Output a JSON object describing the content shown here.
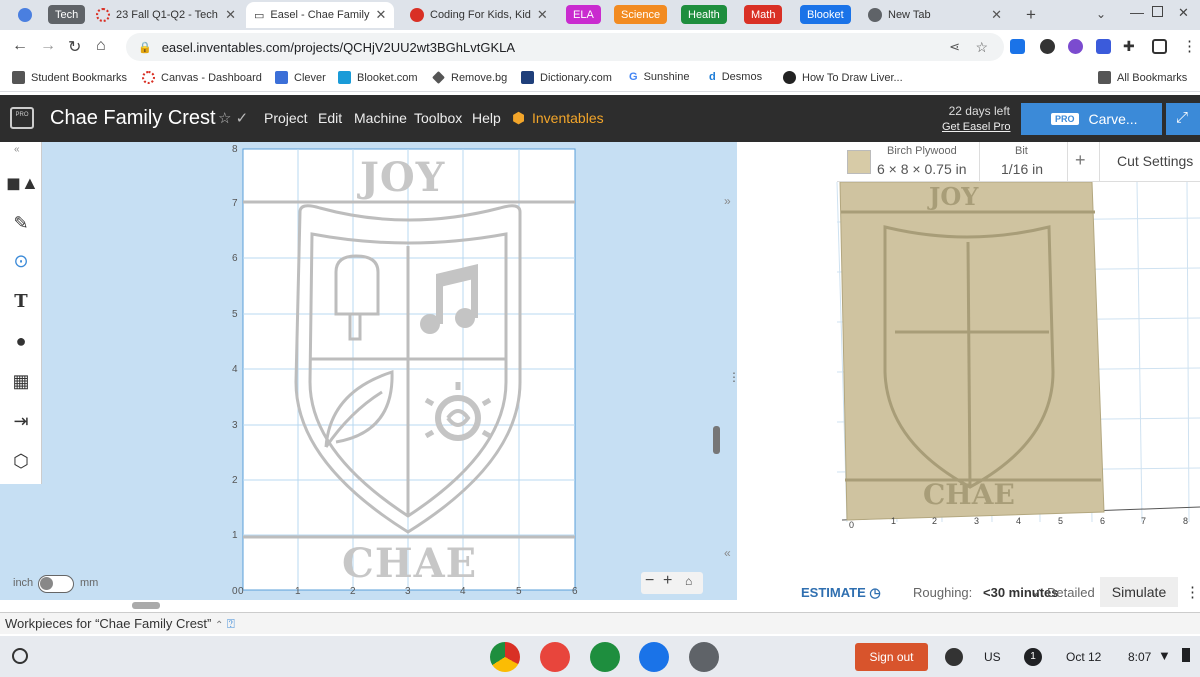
{
  "browser": {
    "tabs": [
      {
        "label": "Tech",
        "color": "#5f6368"
      },
      {
        "label": "23 Fall Q1-Q2 - Tech"
      },
      {
        "label": "Easel - Chae Family"
      },
      {
        "label": "Coding For Kids, Kid"
      },
      {
        "label": "ELA",
        "color": "#c92bcf"
      },
      {
        "label": "Science",
        "color": "#f28b21"
      },
      {
        "label": "Health",
        "color": "#1e8e3e"
      },
      {
        "label": "Math",
        "color": "#d93025"
      },
      {
        "label": "Blooket",
        "color": "#1a73e8"
      },
      {
        "label": "New Tab"
      }
    ],
    "url": "easel.inventables.com/projects/QCHjV2UU2wt3BGhLvtGKLA",
    "bookmarks": [
      "Student Bookmarks",
      "Canvas - Dashboard",
      "Clever",
      "Blooket.com",
      "Remove.bg",
      "Dictionary.com",
      "Sunshine",
      "Desmos",
      "How To Draw Liver...",
      "All Bookmarks"
    ]
  },
  "app": {
    "title": "Chae Family Crest",
    "menu": [
      "Project",
      "Edit",
      "Machine",
      "Toolbox",
      "Help"
    ],
    "brand": "Inventables",
    "trial_days": "22 days left",
    "get_pro": "Get Easel Pro",
    "pro_badge": "PRO",
    "carve_label": "Carve...",
    "logo_text": "PRO"
  },
  "canvas": {
    "units_left": "inch",
    "units_right": "mm",
    "y_ticks": [
      "8",
      "7",
      "6",
      "5",
      "4",
      "3",
      "2",
      "1",
      "0"
    ],
    "x_ticks": [
      "0",
      "1",
      "2",
      "3",
      "4",
      "5",
      "6"
    ],
    "top_text": "JOY",
    "bottom_text": "CHAE"
  },
  "material": {
    "name": "Birch Plywood",
    "size": "6 × 8 × 0.75 in",
    "bit_label": "Bit",
    "bit_value": "1/16 in",
    "cut_settings": "Cut Settings"
  },
  "preview": {
    "x_ticks": [
      "0",
      "1",
      "2",
      "3",
      "4",
      "5",
      "6",
      "7",
      "8"
    ]
  },
  "estimate": {
    "label": "ESTIMATE",
    "roughing_label": "Roughing:",
    "roughing_value": "<30 minutes",
    "detailed": "Detailed",
    "simulate": "Simulate"
  },
  "workpieces": "Workpieces for “Chae Family Crest”",
  "shelf": {
    "sign_out": "Sign out",
    "lang": "US",
    "notif": "1",
    "date": "Oct 12",
    "time": "8:07"
  }
}
